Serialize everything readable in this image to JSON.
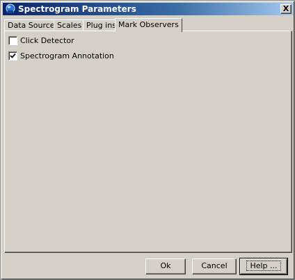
{
  "window": {
    "title": "Spectrogram Parameters",
    "app_icon": "app-globe-icon",
    "close_label": "X"
  },
  "tabs": [
    {
      "label": "Data Source",
      "active": false
    },
    {
      "label": "Scales",
      "active": false
    },
    {
      "label": "Plug ins",
      "active": false
    },
    {
      "label": "Mark Observers",
      "active": true
    }
  ],
  "options": [
    {
      "label": "Click Detector",
      "checked": false
    },
    {
      "label": "Spectrogram Annotation",
      "checked": true
    }
  ],
  "buttons": {
    "ok": "Ok",
    "cancel": "Cancel",
    "help": "Help ..."
  }
}
